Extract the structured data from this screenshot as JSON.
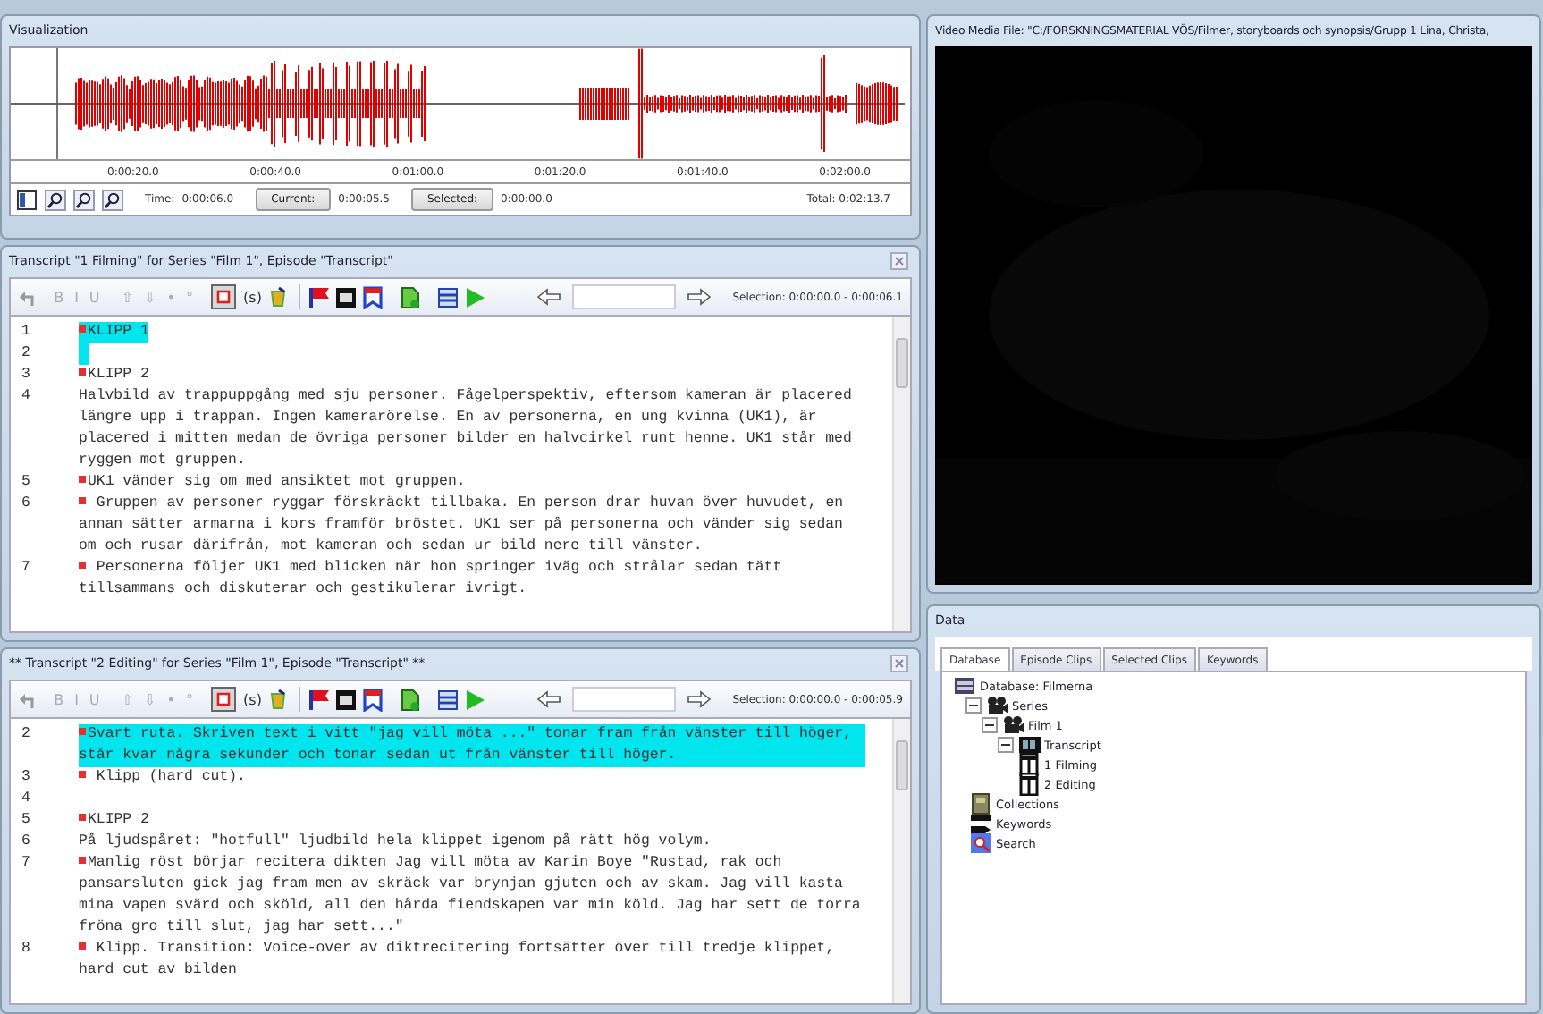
{
  "visualization": {
    "title": "Visualization",
    "time_ticks": [
      "0:00:20.0",
      "0:00:40.0",
      "0:01:00.0",
      "0:01:20.0",
      "0:01:40.0",
      "0:02:00.0"
    ],
    "time_label": "Time:",
    "time_value": "0:00:06.0",
    "current_button": "Current:",
    "current_value": "0:00:05.5",
    "selected_button": "Selected:",
    "selected_value": "0:00:00.0",
    "total": "Total:  0:02:13.7"
  },
  "transcripts": [
    {
      "title": "Transcript \"1 Filming\" for Series \"Film 1\", Episode \"Transcript\"",
      "toolbar": {
        "format": [
          {
            "label": "B",
            "disabled": true
          },
          {
            "label": "I",
            "disabled": true
          },
          {
            "label": "U",
            "disabled": true
          },
          {
            "label": "⇧",
            "disabled": true
          },
          {
            "label": "⇩",
            "disabled": true
          },
          {
            "label": "•",
            "disabled": true
          },
          {
            "label": "°",
            "disabled": true
          }
        ],
        "timecode_pressed": true,
        "symbol_button": "(s)",
        "selection": "Selection:  0:00:00.0 - 0:00:06.1"
      },
      "lines": [
        {
          "number": "1",
          "marker": true,
          "highlighted": true,
          "text": "KLIPP 1"
        },
        {
          "number": "2",
          "marker": false,
          "highlighted": true
        },
        {
          "number": "3",
          "marker": true,
          "highlighted": false,
          "text": "KLIPP 2"
        },
        {
          "number": "4",
          "marker": false,
          "highlighted": false,
          "text": "Halvbild av trappuppgång med sju personer. Fågelperspektiv, eftersom kameran är placered längre upp i trappan. Ingen kamerarörelse. En av personerna, en ung kvinna (UK1), är placered i mitten medan de övriga personer bilder en halvcirkel runt henne. UK1 står med ryggen mot gruppen."
        },
        {
          "number": "5",
          "marker": true,
          "highlighted": false,
          "text": "UK1 vänder sig om med ansiktet mot gruppen."
        },
        {
          "number": "6",
          "marker": true,
          "highlighted": false,
          "text": " Gruppen av personer ryggar förskräckt tillbaka. En person drar huvan över huvudet, en annan sätter armarna i kors framför bröstet. UK1 ser på personerna och vänder sig sedan om och rusar därifrån, mot kameran och sedan ur bild nere till vänster."
        },
        {
          "number": "7",
          "marker": true,
          "highlighted": false,
          "text": " Personerna följer UK1 med blicken när hon springer iväg och strålar sedan tätt tillsammans och diskuterar och gestikulerar ivrigt."
        }
      ]
    },
    {
      "title": "** Transcript \"2 Editing\" for Series \"Film 1\", Episode \"Transcript\" **",
      "toolbar": {
        "format": [
          {
            "label": "B",
            "disabled": true
          },
          {
            "label": "I",
            "disabled": true
          },
          {
            "label": "U",
            "disabled": true
          },
          {
            "label": "⇧",
            "disabled": true
          },
          {
            "label": "⇩",
            "disabled": true
          },
          {
            "label": "•",
            "disabled": true
          },
          {
            "label": "°",
            "disabled": true
          }
        ],
        "timecode_pressed": true,
        "symbol_button": "(s)",
        "selection": "Selection:  0:00:00.0 - 0:00:05.9"
      },
      "lines": [
        {
          "number": "2",
          "marker": true,
          "highlighted": true,
          "text": "Svart ruta. Skriven text i vitt \"jag vill möta ...\" tonar fram från vänster till höger, står kvar några sekunder och tonar sedan ut från vänster till höger."
        },
        {
          "number": "3",
          "marker": true,
          "highlighted": false,
          "text": " Klipp (hard cut)."
        },
        {
          "number": "4",
          "marker": false,
          "highlighted": false
        },
        {
          "number": "5",
          "marker": true,
          "highlighted": false,
          "text": "KLIPP 2"
        },
        {
          "number": "6",
          "marker": false,
          "highlighted": false,
          "text": "På ljudspåret: \"hotfull\" ljudbild hela klippet igenom på rätt hög volym."
        },
        {
          "number": "7",
          "marker": true,
          "highlighted": false,
          "text": "Manlig röst börjar recitera dikten Jag vill möta av Karin Boye \"Rustad, rak och pansarsluten gick jag fram men av skräck var brynjan gjuten och av skam. Jag vill kasta mina vapen svärd och sköld, all den hårda fiendskapen var min köld. Jag har sett de torra fröna gro till slut, jag har sett...\""
        },
        {
          "number": "8",
          "marker": true,
          "highlighted": false,
          "text": " Klipp. Transition: Voice-over av diktrecitering fortsätter över till tredje klippet, hard cut av bilden"
        }
      ]
    }
  ],
  "video": {
    "title": "Video Media File: \"C:/FORSKNINGSMATERIAL VÖS/Filmer, storyboards och synopsis/Grupp 1 Lina, Christa,"
  },
  "data": {
    "title": "Data",
    "tabs": [
      {
        "label": "Database",
        "selected": true
      },
      {
        "label": "Episode Clips",
        "selected": false
      },
      {
        "label": "Selected Clips",
        "selected": false
      },
      {
        "label": "Keywords",
        "selected": false
      }
    ],
    "tree": [
      {
        "label": "Database: Filmerna",
        "kind": "database",
        "children": [
          {
            "label": "Series",
            "kind": "series",
            "expanded": true,
            "children": [
              {
                "label": "Film 1",
                "kind": "series",
                "expanded": true,
                "children": [
                  {
                    "label": "Transcript",
                    "kind": "episode",
                    "expanded": true,
                    "children": [
                      {
                        "label": "1 Filming",
                        "kind": "transcript"
                      },
                      {
                        "label": "2 Editing",
                        "kind": "transcript"
                      }
                    ]
                  }
                ]
              }
            ]
          },
          {
            "label": "Collections",
            "kind": "collection"
          },
          {
            "label": "Keywords",
            "kind": "keyword"
          },
          {
            "label": "Search",
            "kind": "search"
          }
        ]
      }
    ]
  }
}
